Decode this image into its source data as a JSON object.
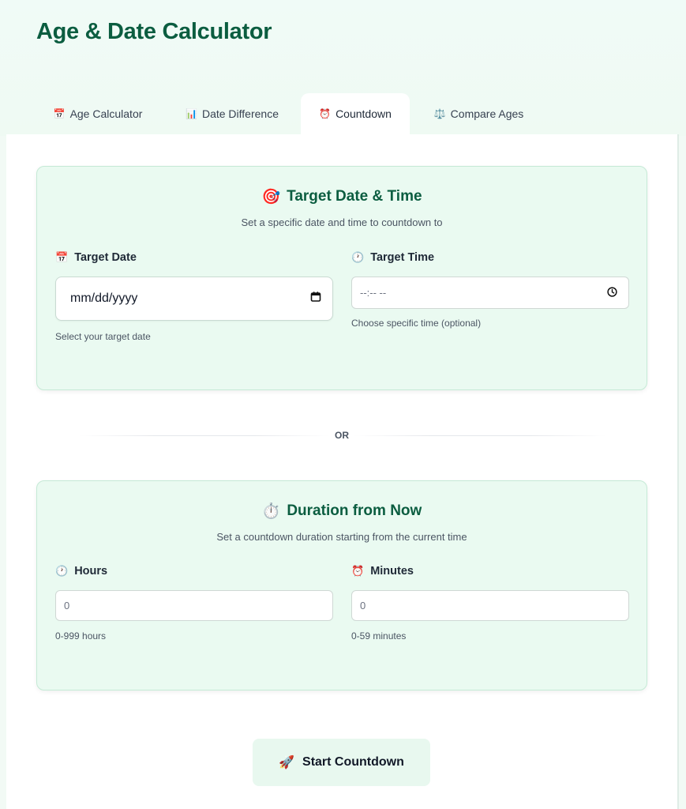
{
  "app": {
    "title": "Age & Date Calculator"
  },
  "tabs": [
    {
      "label": "Age Calculator",
      "icon": "📅",
      "active": false
    },
    {
      "label": "Date Difference",
      "icon": "📊",
      "active": false
    },
    {
      "label": "Countdown",
      "icon": "⏰",
      "active": true
    },
    {
      "label": "Compare Ages",
      "icon": "⚖️",
      "active": false
    }
  ],
  "target_card": {
    "icon": "🎯",
    "title": "Target Date & Time",
    "subtitle": "Set a specific date and time to countdown to",
    "date_label": "Target Date",
    "date_icon": "📅",
    "date_placeholder": "mm/dd/yyyy",
    "date_help": "Select your target date",
    "time_label": "Target Time",
    "time_icon": "🕐",
    "time_placeholder": "--:-- --",
    "time_help": "Choose specific time (optional)"
  },
  "separator": {
    "label": "OR"
  },
  "duration_card": {
    "icon": "⏱️",
    "title": "Duration from Now",
    "subtitle": "Set a countdown duration starting from the current time",
    "hours_label": "Hours",
    "hours_icon": "🕐",
    "hours_value": "0",
    "hours_help": "0-999 hours",
    "minutes_label": "Minutes",
    "minutes_icon": "⏰",
    "minutes_value": "0",
    "minutes_help": "0-59 minutes"
  },
  "actions": {
    "start_icon": "🚀",
    "start_label": "Start Countdown"
  },
  "colors": {
    "accent": "#0b5d40",
    "card_bg": "#eafaf1",
    "card_border": "#c5ead6"
  }
}
